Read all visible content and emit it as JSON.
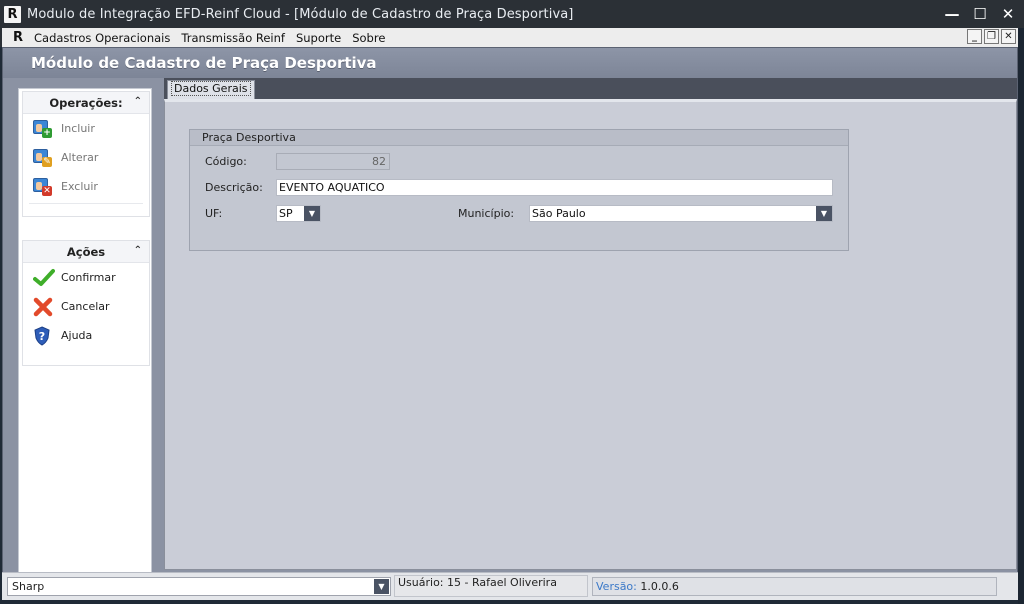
{
  "window": {
    "logo": "R",
    "title": "Modulo de Integração EFD-Reinf Cloud - [Módulo de Cadastro de Praça Desportiva]",
    "minimize": "—",
    "maximize": "☐",
    "close": "✕"
  },
  "menu": {
    "logo": "R",
    "items": [
      "Cadastros Operacionais",
      "Transmissão Reinf",
      "Suporte",
      "Sobre"
    ],
    "mdi_minimize": "_",
    "mdi_restore": "❐",
    "mdi_close": "✕"
  },
  "module_header": "Módulo de Cadastro de Praça Desportiva",
  "sidebar": {
    "operations": {
      "title": "Operações:",
      "collapse_glyph": "⌃",
      "items": [
        {
          "label": "Incluir",
          "icon": "user-card-add-icon"
        },
        {
          "label": "Alterar",
          "icon": "user-card-edit-icon"
        },
        {
          "label": "Excluir",
          "icon": "user-card-delete-icon"
        }
      ]
    },
    "actions": {
      "title": "Ações",
      "collapse_glyph": "⌃",
      "items": [
        {
          "label": "Confirmar",
          "icon": "check-icon"
        },
        {
          "label": "Cancelar",
          "icon": "x-icon"
        },
        {
          "label": "Ajuda",
          "icon": "help-shield-icon"
        }
      ]
    }
  },
  "tabs": [
    "Dados Gerais"
  ],
  "form": {
    "group_title": "Praça Desportiva",
    "codigo_label": "Código:",
    "codigo_value": "82",
    "descricao_label": "Descrição:",
    "descricao_value": "EVENTO AQUATICO",
    "uf_label": "UF:",
    "uf_value": "SP",
    "municipio_label": "Município:",
    "municipio_value": "São Paulo"
  },
  "status": {
    "skin": "Sharp",
    "user": "Usuário: 15 - Rafael Oliverira",
    "version_label": "Versão:",
    "version_value": "1.0.0.6"
  },
  "colors": {
    "titlebar": "#2b3036",
    "header": "#848c9e",
    "content_bg": "#cacdd7",
    "accent_blue": "#3a78c8"
  }
}
